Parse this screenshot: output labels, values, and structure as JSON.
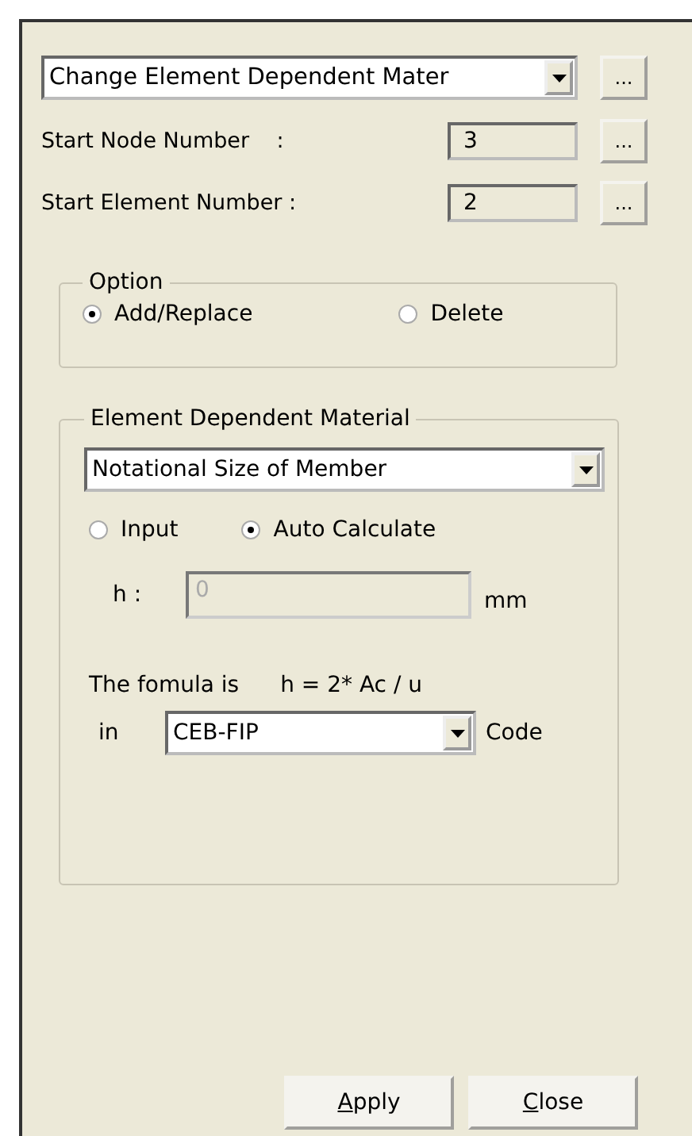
{
  "command": {
    "value": "Change Element Dependent Mater"
  },
  "start_fields": [
    {
      "label": "Start Node Number    :",
      "value": "3"
    },
    {
      "label": "Start Element Number :",
      "value": "2"
    }
  ],
  "option": {
    "title": "Option",
    "choices": [
      {
        "label": "Add/Replace",
        "selected": true
      },
      {
        "label": "Delete",
        "selected": false
      }
    ]
  },
  "material": {
    "title": "Element Dependent Material",
    "property": "Notational Size of Member",
    "modes": [
      {
        "label": "Input",
        "selected": false
      },
      {
        "label": "Auto Calculate",
        "selected": true
      }
    ],
    "h": {
      "label": "h :",
      "value": "0",
      "unit": "mm",
      "disabled": true
    },
    "formula_label": "The fomula is",
    "formula": "h = 2* Ac / u",
    "code_prefix": "in",
    "code": "CEB-FIP",
    "code_suffix": "Code"
  },
  "buttons": [
    {
      "key": "A",
      "rest": "pply"
    },
    {
      "key": "C",
      "rest": "lose"
    }
  ],
  "browse_label": "..."
}
